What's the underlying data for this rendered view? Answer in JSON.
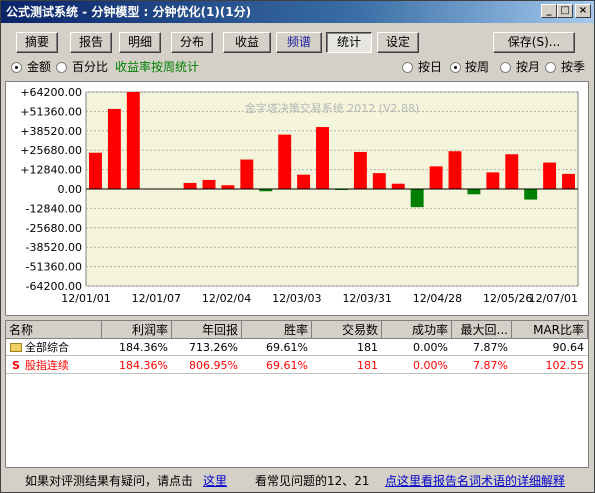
{
  "window": {
    "title": "公式测试系统 - 分钟模型 : 分钟优化(1)(1分)",
    "min": "_",
    "max": "□",
    "close": "×"
  },
  "toolbar": {
    "tabs": [
      "摘要",
      "报告",
      "明细",
      "分布",
      "收益",
      "频谱",
      "统计",
      "设定"
    ],
    "active_tab": "统计",
    "save_label": "保存(S)..."
  },
  "options": {
    "amount": "金额",
    "percent": "百分比",
    "note": "收益率按周统计",
    "note_color": "#008000",
    "by_day": "按日",
    "by_week": "按周",
    "by_month": "按月",
    "by_quarter": "按季"
  },
  "chart_data": {
    "type": "bar",
    "watermark": "金字塔决策交易系统 2012 (V2.88)",
    "ylim": [
      -64200,
      64200
    ],
    "y_ticks": [
      "+64200.00",
      "+51360.00",
      "+38520.00",
      "+25680.00",
      "+12840.00",
      "0.00",
      "-12840.00",
      "-25680.00",
      "-38520.00",
      "-51360.00",
      "-64200.00"
    ],
    "x_ticks": [
      "12/01/01",
      "12/01/07",
      "12/02/04",
      "12/03/03",
      "12/03/31",
      "12/04/28",
      "12/05/26",
      "12/07/01"
    ],
    "positive_color": "#ff0000",
    "negative_color": "#008000",
    "values": [
      24000,
      53000,
      64200,
      0,
      0,
      4000,
      6000,
      2500,
      19500,
      -1500,
      36000,
      9500,
      41000,
      -500,
      24500,
      10500,
      3500,
      -12000,
      15000,
      25000,
      -3500,
      11000,
      23000,
      -7000,
      17500,
      10000
    ]
  },
  "table": {
    "columns": [
      "名称",
      "利润率",
      "年回报",
      "胜率",
      "交易数",
      "成功率",
      "最大回...",
      "MAR比率"
    ],
    "rows": [
      {
        "icon": "folder-icon",
        "cells": [
          "全部综合",
          "184.36%",
          "713.26%",
          "69.61%",
          "181",
          "0.00%",
          "7.87%",
          "90.64"
        ],
        "color": "#000000"
      },
      {
        "icon": "S",
        "cells": [
          "股指连续",
          "184.36%",
          "806.95%",
          "69.61%",
          "181",
          "0.00%",
          "7.87%",
          "102.55"
        ],
        "color": "#ff0000"
      }
    ]
  },
  "status": {
    "text1": "如果对评测结果有疑问，请点击",
    "link1": "这里",
    "text2": "看常见问题的12、21",
    "link2": "点这里看报告名词术语的详细解释"
  }
}
